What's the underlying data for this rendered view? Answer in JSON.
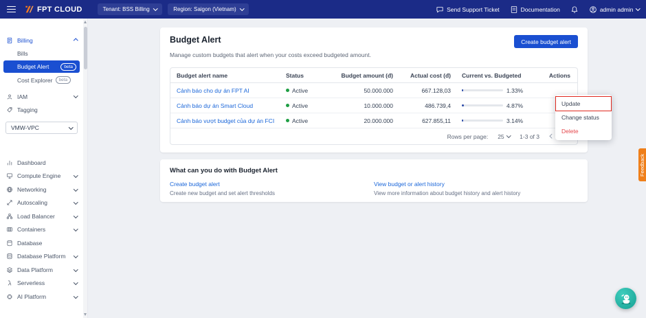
{
  "topbar": {
    "brand": "FPT CLOUD",
    "tenant": "Tenant: BSS Billing",
    "region": "Region: Saigon (Vietnam)",
    "support": "Send Support Ticket",
    "docs": "Documentation",
    "user": "admin admin"
  },
  "sidebar": {
    "sections": {
      "billing": "Billing",
      "iam": "IAM",
      "tagging": "Tagging"
    },
    "billing_items": [
      {
        "label": "Bills",
        "badge": ""
      },
      {
        "label": "Budget Alert",
        "badge": "beta"
      },
      {
        "label": "Cost Explorer",
        "badge": "beta"
      }
    ],
    "vpc": "VMW-VPC",
    "menu": [
      {
        "label": "Dashboard"
      },
      {
        "label": "Compute Engine"
      },
      {
        "label": "Networking"
      },
      {
        "label": "Autoscaling"
      },
      {
        "label": "Load Balancer"
      },
      {
        "label": "Containers"
      },
      {
        "label": "Database"
      },
      {
        "label": "Database Platform"
      },
      {
        "label": "Data Platform"
      },
      {
        "label": "Serverless"
      },
      {
        "label": "AI Platform"
      }
    ]
  },
  "page": {
    "title": "Budget Alert",
    "subtitle": "Manage custom budgets that alert when your costs exceed budgeted amount.",
    "create_button": "Create budget alert"
  },
  "table": {
    "headers": [
      "Budget alert name",
      "Status",
      "Budget amount (đ)",
      "Actual cost (đ)",
      "Current vs. Budgeted",
      "Actions"
    ],
    "rows": [
      {
        "name": "Cảnh báo cho dự án FPT AI",
        "status": "Active",
        "budget": "50.000.000",
        "actual": "667.128,03",
        "percent": "1.33%",
        "percent_value": 1.33
      },
      {
        "name": "Cảnh báo dự án Smart Cloud",
        "status": "Active",
        "budget": "10.000.000",
        "actual": "486.739,4",
        "percent": "4.87%",
        "percent_value": 4.87
      },
      {
        "name": "Cảnh báo vượt budget của dự án FCI",
        "status": "Active",
        "budget": "20.000.000",
        "actual": "627.855,11",
        "percent": "3.14%",
        "percent_value": 3.14
      }
    ],
    "pagination": {
      "rows_per_page_label": "Rows per page:",
      "rows_per_page": "25",
      "range": "1-3 of 3"
    }
  },
  "action_menu": {
    "items": [
      {
        "label": "Update"
      },
      {
        "label": "Change status"
      },
      {
        "label": "Delete"
      }
    ]
  },
  "help": {
    "title": "What can you do with Budget Alert",
    "items": [
      {
        "link": "Create budget alert",
        "desc": "Create new budget and set alert thresholds"
      },
      {
        "link": "View budget or alert history",
        "desc": "View more information about budget history and alert history"
      }
    ]
  },
  "feedback": "Feedback",
  "colors": {
    "navbar_blue": "#1b2b87",
    "accent_blue": "#1a4fd1",
    "link_blue": "#1a66d9",
    "active_green": "#1e9e44",
    "danger_red": "#e5484d",
    "annotation_red": "#e0281e",
    "feedback_orange": "#ef7f1a",
    "assistant_teal": "#23b3a4"
  }
}
